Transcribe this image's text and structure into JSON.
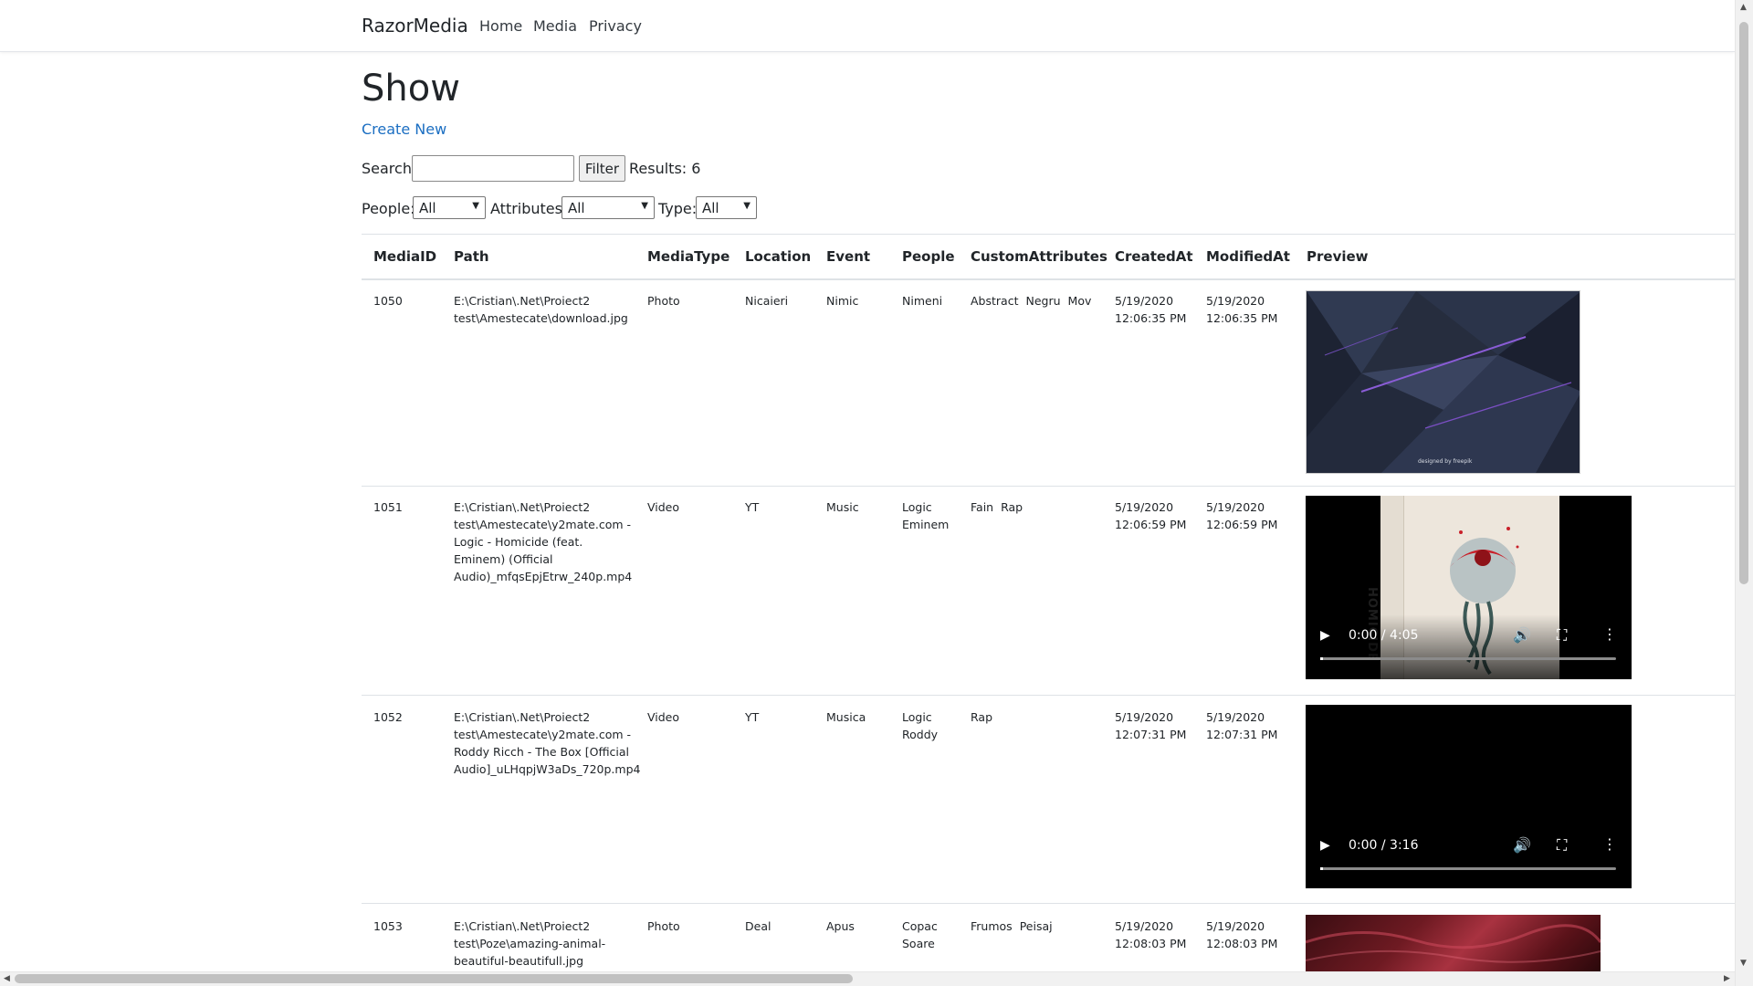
{
  "nav": {
    "brand": "RazorMedia",
    "links": [
      "Home",
      "Media",
      "Privacy"
    ]
  },
  "page": {
    "title": "Show",
    "create_link": "Create New"
  },
  "filters": {
    "search_label": "Search:",
    "search_value": "",
    "filter_button": "Filter",
    "results": "Results: 6",
    "people_label": "People:",
    "people_value": "All",
    "attributes_label": "Attributes:",
    "attributes_value": "All",
    "type_label": "Type:",
    "type_value": "All"
  },
  "table": {
    "headers": [
      "MediaID",
      "Path",
      "MediaType",
      "Location",
      "Event",
      "People",
      "CustomAttributes",
      "CreatedAt",
      "ModifiedAt",
      "Preview"
    ],
    "rows": [
      {
        "id": "1050",
        "path": "E:\\Cristian\\.Net\\Proiect2 test\\Amestecate\\download.jpg",
        "type": "Photo",
        "location": "Nicaieri",
        "event": "Nimic",
        "people": [
          "Nimeni"
        ],
        "attributes": [
          "Abstract",
          "Negru",
          "Mov"
        ],
        "created_date": "5/19/2020",
        "created_time": "12:06:35 PM",
        "modified_date": "5/19/2020",
        "modified_time": "12:06:35 PM",
        "preview": {
          "kind": "photo",
          "caption": "designed by freepik"
        }
      },
      {
        "id": "1051",
        "path": "E:\\Cristian\\.Net\\Proiect2 test\\Amestecate\\y2mate.com - Logic - Homicide (feat. Eminem) (Official Audio)_mfqsEpjEtrw_240p.mp4",
        "type": "Video",
        "location": "YT",
        "event": "Music",
        "people": [
          "Logic",
          "Eminem"
        ],
        "attributes": [
          "Fain",
          "Rap"
        ],
        "created_date": "5/19/2020",
        "created_time": "12:06:59 PM",
        "modified_date": "5/19/2020",
        "modified_time": "12:06:59 PM",
        "preview": {
          "kind": "video",
          "time": "0:00 / 4:05",
          "cover_text": "HOMICIDE"
        }
      },
      {
        "id": "1052",
        "path": "E:\\Cristian\\.Net\\Proiect2 test\\Amestecate\\y2mate.com - Roddy Ricch - The Box [Official Audio]_uLHqpjW3aDs_720p.mp4",
        "type": "Video",
        "location": "YT",
        "event": "Musica",
        "people": [
          "Logic",
          "Roddy"
        ],
        "attributes": [
          "Rap"
        ],
        "created_date": "5/19/2020",
        "created_time": "12:07:31 PM",
        "modified_date": "5/19/2020",
        "modified_time": "12:07:31 PM",
        "preview": {
          "kind": "video",
          "time": "0:00 / 3:16"
        }
      },
      {
        "id": "1053",
        "path": "E:\\Cristian\\.Net\\Proiect2 test\\Poze\\amazing-animal-beautiful-beautifull.jpg",
        "type": "Photo",
        "location": "Deal",
        "event": "Apus",
        "people": [
          "Copac",
          "Soare"
        ],
        "attributes": [
          "Frumos",
          "Peisaj"
        ],
        "created_date": "5/19/2020",
        "created_time": "12:08:03 PM",
        "modified_date": "5/19/2020",
        "modified_time": "12:08:03 PM",
        "preview": {
          "kind": "photo"
        }
      }
    ]
  },
  "colors": {
    "link": "#1b6ec2",
    "border": "#dee2e6",
    "video_bg": "#000000"
  }
}
